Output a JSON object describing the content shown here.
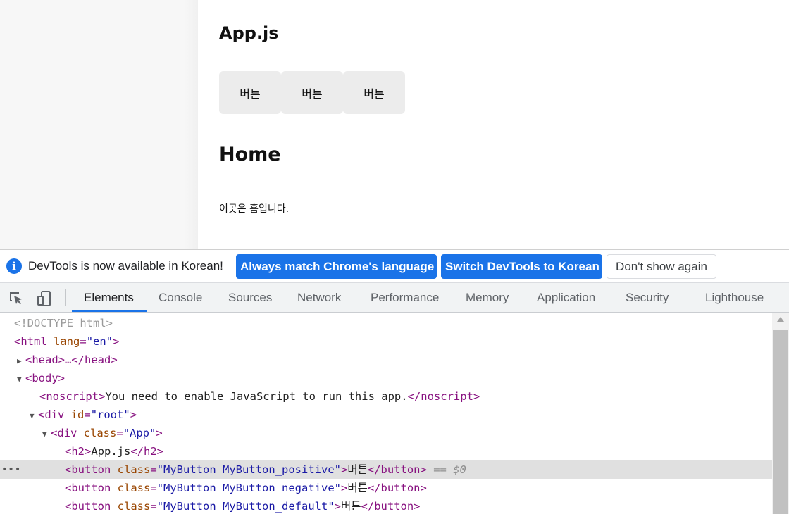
{
  "page": {
    "app_title": "App.js",
    "buttons": [
      {
        "label": "버튼"
      },
      {
        "label": "버튼"
      },
      {
        "label": "버튼"
      }
    ],
    "home_title": "Home",
    "home_text": "이곳은 홈입니다."
  },
  "devtools": {
    "infobar": {
      "icon": "info-icon",
      "message": "DevTools is now available in Korean!",
      "match_label": "Always match Chrome's language",
      "switch_label": "Switch DevTools to Korean",
      "dont_show_label": "Don't show again"
    },
    "tabs": [
      {
        "label": "Elements",
        "active": true
      },
      {
        "label": "Console"
      },
      {
        "label": "Sources"
      },
      {
        "label": "Network"
      },
      {
        "label": "Performance"
      },
      {
        "label": "Memory"
      },
      {
        "label": "Application"
      },
      {
        "label": "Security"
      },
      {
        "label": "Lighthouse"
      }
    ],
    "dom": {
      "doctype": "<!DOCTYPE html>",
      "html_open": "<html",
      "html_lang_attr": "lang",
      "html_lang_val": "\"en\"",
      "head_collapsed": "<head>…</head>",
      "body_open": "<body>",
      "noscript_open": "<noscript>",
      "noscript_text": "You need to enable JavaScript to run this app.",
      "noscript_close": "</noscript>",
      "div_open": "<div",
      "id_attr": "id",
      "root_val": "\"root\"",
      "class_attr": "class",
      "app_val": "\"App\"",
      "h2_open": "<h2>",
      "h2_text": "App.js",
      "h2_close": "</h2>",
      "button_open": "<button",
      "positive_val": "\"MyButton MyButton_positive\"",
      "negative_val": "\"MyButton MyButton_negative\"",
      "default_val": "\"MyButton MyButton_default\"",
      "button_text": "버튼",
      "button_close": "</button>",
      "selected_marker": "== $0",
      "gutter_ellipsis": "•••"
    }
  }
}
